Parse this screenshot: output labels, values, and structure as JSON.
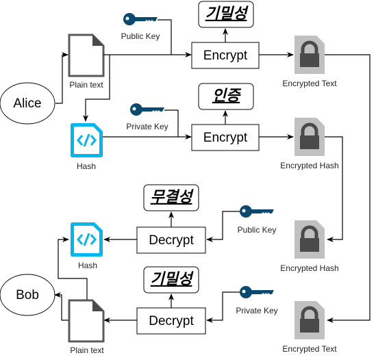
{
  "actors": {
    "sender": "Alice",
    "receiver": "Bob"
  },
  "labels": {
    "plain_text": "Plain text",
    "hash": "Hash",
    "public_key": "Public Key",
    "private_key": "Private Key",
    "encrypted_text": "Encrypted Text",
    "encrypted_hash": "Encrypted Hash"
  },
  "operations": {
    "encrypt": "Encrypt",
    "decrypt": "Decrypt"
  },
  "properties": {
    "confidentiality": "기밀성",
    "authentication": "인증",
    "integrity": "무결성"
  },
  "colors": {
    "key": "#0b4a6f",
    "hash": "#00b7f0",
    "lock_bg": "#c0c0c0",
    "lock": "#4a4a4a",
    "doc": "#555555"
  }
}
